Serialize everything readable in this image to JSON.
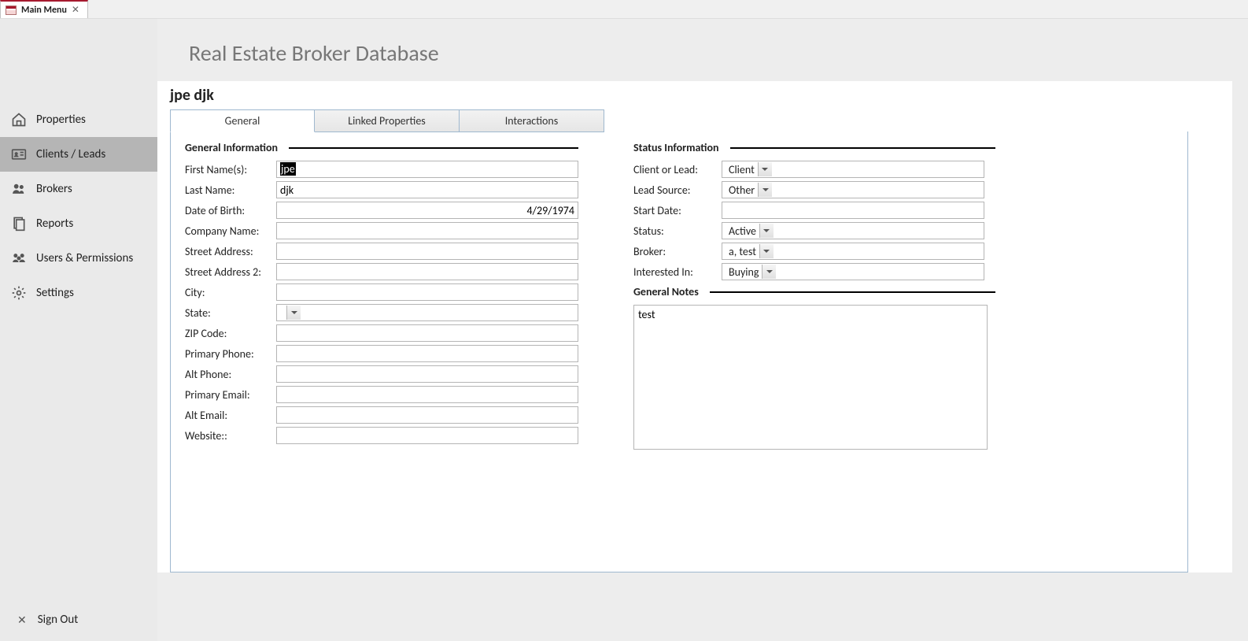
{
  "tab": {
    "title": "Main Menu"
  },
  "appTitle": "Real Estate Broker Database",
  "collapseHandle": "<<",
  "sidebar": {
    "items": [
      {
        "label": "Properties"
      },
      {
        "label": "Clients / Leads"
      },
      {
        "label": "Brokers"
      },
      {
        "label": "Reports"
      },
      {
        "label": "Users & Permissions"
      },
      {
        "label": "Settings"
      }
    ],
    "signOut": "Sign Out"
  },
  "record": {
    "title": "jpe djk",
    "tabs": [
      "General",
      "Linked Properties",
      "Interactions"
    ],
    "sections": {
      "generalInfo": "General Information",
      "statusInfo": "Status Information",
      "generalNotes": "General Notes"
    },
    "labels": {
      "firstName": "First Name(s):",
      "lastName": "Last Name:",
      "dob": "Date of Birth:",
      "company": "Company Name:",
      "street1": "Street Address:",
      "street2": "Street Address 2:",
      "city": "City:",
      "state": "State:",
      "zip": "ZIP Code:",
      "primaryPhone": "Primary Phone:",
      "altPhone": "Alt Phone:",
      "primaryEmail": "Primary Email:",
      "altEmail": "Alt Email:",
      "website": "Website::",
      "clientOrLead": "Client or Lead:",
      "leadSource": "Lead Source:",
      "startDate": "Start Date:",
      "status": "Status:",
      "broker": "Broker:",
      "interestedIn": "Interested In:"
    },
    "values": {
      "firstName": "jpe",
      "lastName": "djk",
      "dob": "4/29/1974",
      "company": "",
      "street1": "",
      "street2": "",
      "city": "",
      "state": "",
      "zip": "",
      "primaryPhone": "",
      "altPhone": "",
      "primaryEmail": "",
      "altEmail": "",
      "website": "",
      "clientOrLead": "Client",
      "leadSource": "Other",
      "startDate": "",
      "status": "Active",
      "broker": "a, test",
      "interestedIn": "Buying",
      "notes": "test"
    }
  }
}
